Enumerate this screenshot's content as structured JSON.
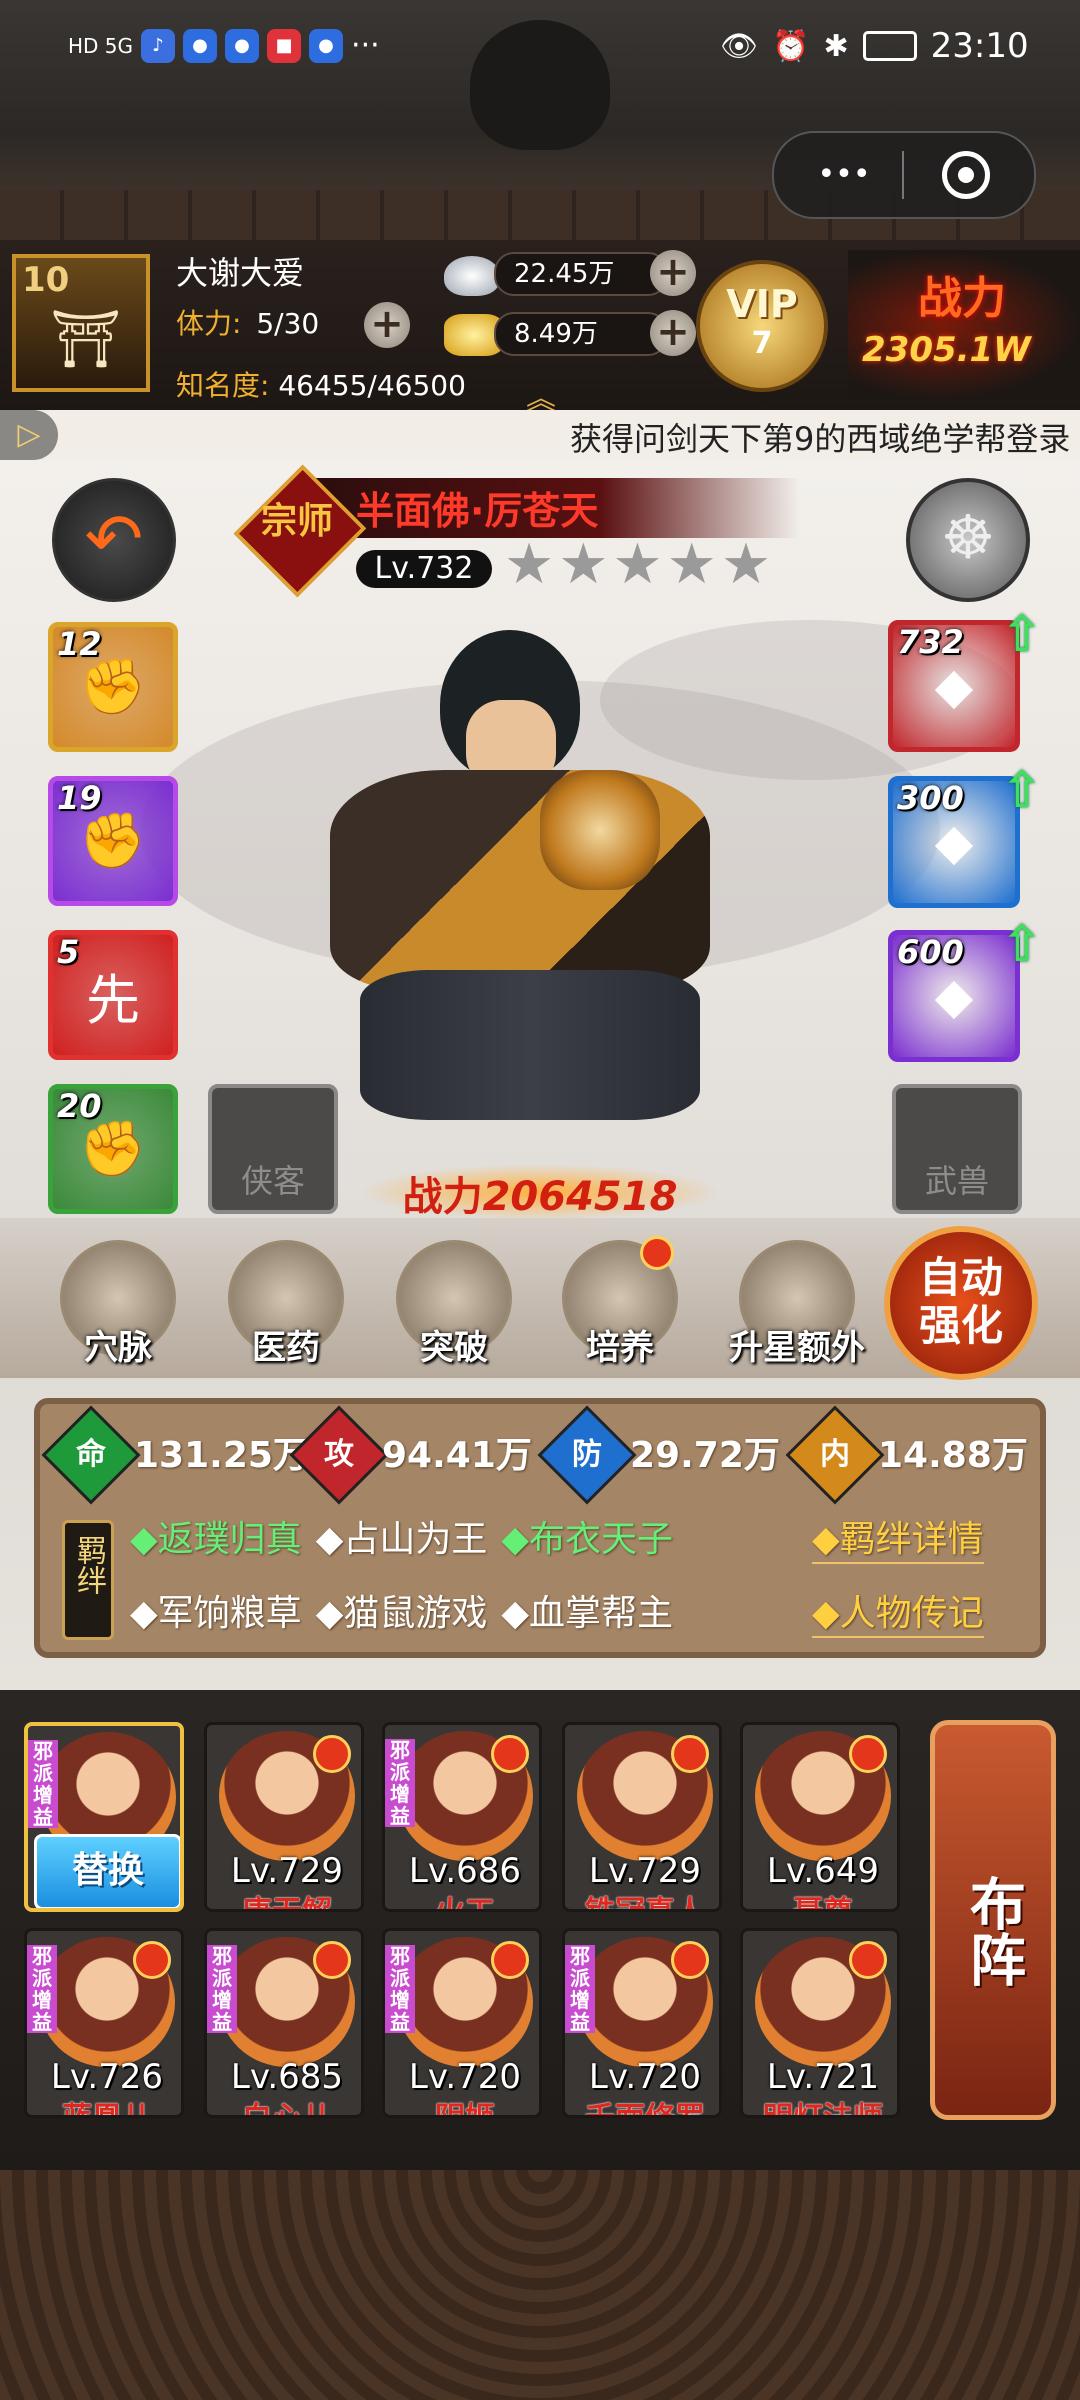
{
  "status_bar": {
    "time": "23:10",
    "network": "HD 5G",
    "more": "···"
  },
  "capsule": {
    "more_label": "•••"
  },
  "player": {
    "level": "10",
    "name": "大谢大爱",
    "stamina_label": "体力:",
    "stamina_value": "5/30",
    "fame_label": "知名度:",
    "fame_value": "46455/46500",
    "silver": "22.45万",
    "gold": "8.49万",
    "vip_label": "VIP",
    "vip_level": "7",
    "power_banner_label": "战力",
    "power_banner_value": "2305.1W"
  },
  "ticker": {
    "text": "获得问剑天下第9的西域绝学帮登录"
  },
  "hero": {
    "rank_badge": "宗师",
    "name": "半面佛·厉苍天",
    "level": "Lv.732",
    "stars": 5,
    "power_label": "战力",
    "power_value": "2064518"
  },
  "left_skills": [
    {
      "level": "12",
      "icon": "palm-skill-icon",
      "color": "#d4892a"
    },
    {
      "level": "19",
      "icon": "fist-skill-icon",
      "color": "#7b2fd0"
    },
    {
      "level": "5",
      "icon": "first-strike-skill-icon",
      "color": "#d02020",
      "mark": "先"
    },
    {
      "level": "20",
      "icon": "fist-emblem-skill-icon",
      "color": "#3a8a3a"
    }
  ],
  "companion_slot": {
    "label": "侠客"
  },
  "right_equips": [
    {
      "level": "732",
      "icon": "gauntlet-icon",
      "color": "#c0262c"
    },
    {
      "level": "300",
      "icon": "robe-icon",
      "color": "#1f6fcf"
    },
    {
      "level": "600",
      "icon": "jade-amulet-icon",
      "color": "#7b2fd0"
    }
  ],
  "beast_slot": {
    "label": "武兽"
  },
  "menu": [
    {
      "label": "穴脉",
      "icon": "meridian-icon",
      "dot": false
    },
    {
      "label": "医药",
      "icon": "medicine-icon",
      "dot": false
    },
    {
      "label": "突破",
      "icon": "breakthrough-icon",
      "dot": false
    },
    {
      "label": "培养",
      "icon": "cultivate-icon",
      "dot": true
    },
    {
      "label": "升星额外",
      "icon": "star-up-icon",
      "dot": false
    }
  ],
  "auto_button": {
    "line1": "自动",
    "line2": "强化"
  },
  "stats": [
    {
      "label": "命",
      "value": "131.25万",
      "color": "#1f9a3a"
    },
    {
      "label": "攻",
      "value": "94.41万",
      "color": "#c0262c"
    },
    {
      "label": "防",
      "value": "29.72万",
      "color": "#1f6fcf"
    },
    {
      "label": "内",
      "value": "14.88万",
      "color": "#d48a1a"
    }
  ],
  "bonds": {
    "title": "羁绊",
    "items_row1": [
      {
        "text": "◆返璞归真",
        "active": true
      },
      {
        "text": "◆占山为王",
        "active": false
      },
      {
        "text": "◆布衣天子",
        "active": true
      }
    ],
    "items_row2": [
      {
        "text": "◆军饷粮草",
        "active": false
      },
      {
        "text": "◆猫鼠游戏",
        "active": false
      },
      {
        "text": "◆血掌帮主",
        "active": false
      }
    ],
    "detail_link": "◆羁绊详情",
    "bio_link": "◆人物传记"
  },
  "team": {
    "replace_label": "替换",
    "tag_text": "邪派增益",
    "row1": [
      {
        "level": "",
        "name": "",
        "selected": true,
        "tag": true
      },
      {
        "level": "Lv.729",
        "name": "唐无解",
        "tag": false
      },
      {
        "level": "Lv.686",
        "name": "火工",
        "tag": true
      },
      {
        "level": "Lv.729",
        "name": "铁冠真人",
        "tag": false
      },
      {
        "level": "Lv.649",
        "name": "聂尊",
        "tag": false
      }
    ],
    "row2": [
      {
        "level": "Lv.726",
        "name": "蓝凰儿",
        "tag": true
      },
      {
        "level": "Lv.685",
        "name": "白心儿",
        "tag": true
      },
      {
        "level": "Lv.720",
        "name": "阴姬",
        "tag": true
      },
      {
        "level": "Lv.720",
        "name": "千面修罗",
        "tag": true
      },
      {
        "level": "Lv.721",
        "name": "明灯法师",
        "tag": false
      }
    ],
    "formation_label": "布阵"
  }
}
